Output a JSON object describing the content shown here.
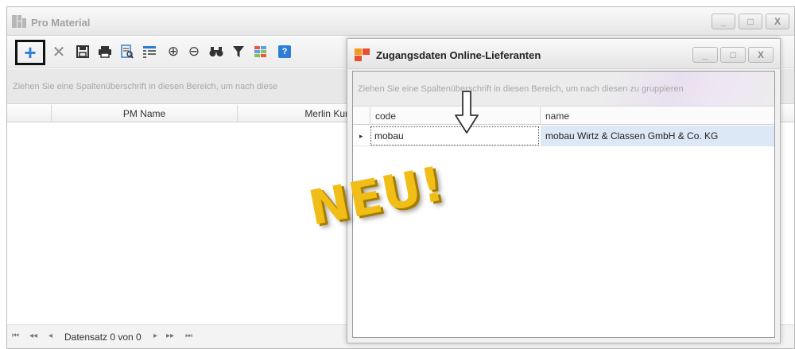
{
  "main_window": {
    "title": "Pro Material",
    "window_controls": [
      "_",
      "□",
      "X"
    ],
    "toolbar": {
      "add": "+",
      "delete": "✕",
      "save": "🖫",
      "print": "🖶",
      "preview": "🗎",
      "columns": "▦",
      "zoom_in": "⊕",
      "zoom_out": "⊖",
      "find": "🔭",
      "filter": "▼",
      "layout": "▩",
      "help": "?"
    },
    "group_hint": "Ziehen Sie eine Spaltenüberschrift in diesen Bereich, um nach diese",
    "columns": [
      "PM Name",
      "Merlin Kurz"
    ],
    "navigator": {
      "first": "⏮",
      "prev_page": "◂◂",
      "prev": "◂",
      "record_text": "Datensatz 0 von 0",
      "next": "▸",
      "next_page": "▸▸",
      "last": "⏭"
    }
  },
  "dialog": {
    "title": "Zugangsdaten Online-Lieferanten",
    "window_controls": [
      "_",
      "□",
      "X"
    ],
    "group_hint": "Ziehen Sie eine Spaltenüberschrift in diesen Bereich, um nach diesen zu gruppieren",
    "columns": [
      "code",
      "name"
    ],
    "rows": [
      {
        "indicator": "▸",
        "code": "mobau",
        "name": "mobau Wirtz & Classen GmbH & Co. KG"
      }
    ]
  },
  "overlay": {
    "badge_text": "NEU!",
    "arrow": "⇩"
  },
  "colors": {
    "badge": "#f1bd17",
    "add_button": "#2d7fd6",
    "selected_cell": "#dde8f7"
  }
}
